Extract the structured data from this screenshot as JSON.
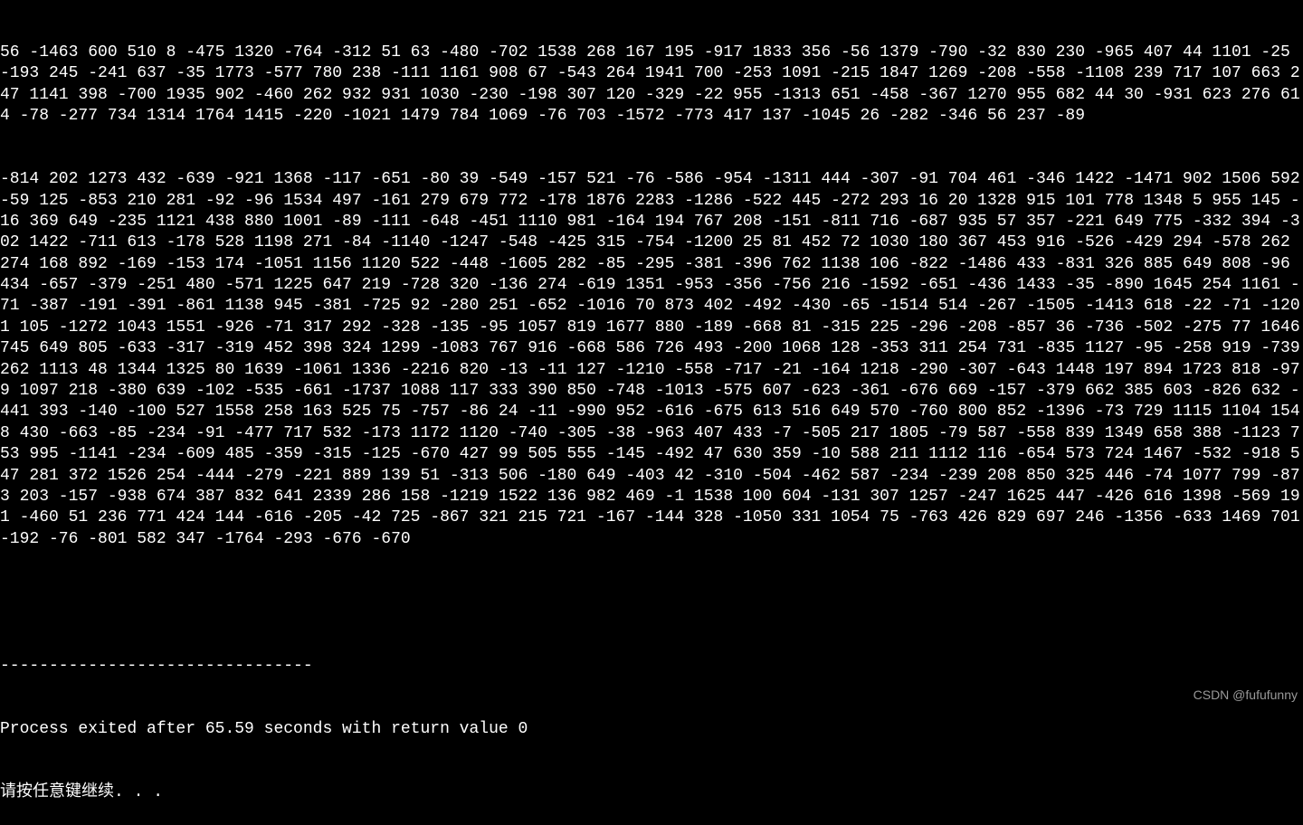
{
  "console": {
    "numbers_block1": "56 -1463 600 510 8 -475 1320 -764 -312 51 63 -480 -702 1538 268 167 195 -917 1833 356 -56 1379 -790 -32 830 230 -965 407 44 1101 -25 -193 245 -241 637 -35 1773 -577 780 238 -111 1161 908 67 -543 264 1941 700 -253 1091 -215 1847 1269 -208 -558 -1108 239 717 107 663 247 1141 398 -700 1935 902 -460 262 932 931 1030 -230 -198 307 120 -329 -22 955 -1313 651 -458 -367 1270 955 682 44 30 -931 623 276 614 -78 -277 734 1314 1764 1415 -220 -1021 1479 784 1069 -76 703 -1572 -773 417 137 -1045 26 -282 -346 56 237 -89",
    "numbers_block2": "-814 202 1273 432 -639 -921 1368 -117 -651 -80 39 -549 -157 521 -76 -586 -954 -1311 444 -307 -91 704 461 -346 1422 -1471 902 1506 592 -59 125 -853 210 281 -92 -96 1534 497 -161 279 679 772 -178 1876 2283 -1286 -522 445 -272 293 16 20 1328 915 101 778 1348 5 955 145 -16 369 649 -235 1121 438 880 1001 -89 -111 -648 -451 1110 981 -164 194 767 208 -151 -811 716 -687 935 57 357 -221 649 775 -332 394 -302 1422 -711 613 -178 528 1198 271 -84 -1140 -1247 -548 -425 315 -754 -1200 25 81 452 72 1030 180 367 453 916 -526 -429 294 -578 262 274 168 892 -169 -153 174 -1051 1156 1120 522 -448 -1605 282 -85 -295 -381 -396 762 1138 106 -822 -1486 433 -831 326 885 649 808 -96 434 -657 -379 -251 480 -571 1225 647 219 -728 320 -136 274 -619 1351 -953 -356 -756 216 -1592 -651 -436 1433 -35 -890 1645 254 1161 -71 -387 -191 -391 -861 1138 945 -381 -725 92 -280 251 -652 -1016 70 873 402 -492 -430 -65 -1514 514 -267 -1505 -1413 618 -22 -71 -1201 105 -1272 1043 1551 -926 -71 317 292 -328 -135 -95 1057 819 1677 880 -189 -668 81 -315 225 -296 -208 -857 36 -736 -502 -275 77 1646 745 649 805 -633 -317 -319 452 398 324 1299 -1083 767 916 -668 586 726 493 -200 1068 128 -353 311 254 731 -835 1127 -95 -258 919 -739 262 1113 48 1344 1325 80 1639 -1061 1336 -2216 820 -13 -11 127 -1210 -558 -717 -21 -164 1218 -290 -307 -643 1448 197 894 1723 818 -979 1097 218 -380 639 -102 -535 -661 -1737 1088 117 333 390 850 -748 -1013 -575 607 -623 -361 -676 669 -157 -379 662 385 603 -826 632 -441 393 -140 -100 527 1558 258 163 525 75 -757 -86 24 -11 -990 952 -616 -675 613 516 649 570 -760 800 852 -1396 -73 729 1115 1104 1548 430 -663 -85 -234 -91 -477 717 532 -173 1172 1120 -740 -305 -38 -963 407 433 -7 -505 217 1805 -79 587 -558 839 1349 658 388 -1123 753 995 -1141 -234 -609 485 -359 -315 -125 -670 427 99 505 555 -145 -492 47 630 359 -10 588 211 1112 116 -654 573 724 1467 -532 -918 547 281 372 1526 254 -444 -279 -221 889 139 51 -313 506 -180 649 -403 42 -310 -504 -462 587 -234 -239 208 850 325 446 -74 1077 799 -873 203 -157 -938 674 387 832 641 2339 286 158 -1219 1522 136 982 469 -1 1538 100 604 -131 307 1257 -247 1625 447 -426 616 1398 -569 191 -460 51 236 771 424 144 -616 -205 -42 725 -867 321 215 721 -167 -144 328 -1050 331 1054 75 -763 426 829 697 246 -1356 -633 1469 701 -192 -76 -801 582 347 -1764 -293 -676 -670",
    "separator": "--------------------------------",
    "status": "Process exited after 65.59 seconds with return value 0",
    "prompt": "请按任意键继续. . ."
  },
  "watermark": "CSDN @fufufunny"
}
